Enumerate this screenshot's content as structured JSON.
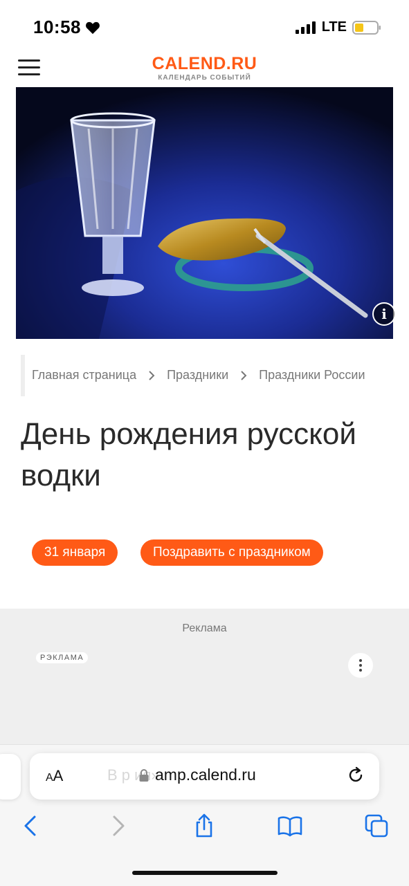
{
  "status_bar": {
    "time": "10:58",
    "network": "LTE",
    "heart_icon": "heart-icon",
    "signal_icon": "signal-bars-icon",
    "battery_icon": "battery-icon"
  },
  "header": {
    "menu_icon": "hamburger-icon",
    "logo_main": "CALEND.RU",
    "logo_sub": "КАЛЕНДАРЬ СОБЫТИЙ",
    "brand_color": "#ff5a16"
  },
  "hero": {
    "info_label": "i"
  },
  "breadcrumb": {
    "items": [
      "Главная страница",
      "Праздники",
      "Праздники России"
    ],
    "separator": ">"
  },
  "page": {
    "title": "День рождения русской водки",
    "date_button": "31 января",
    "congrats_button": "Поздравить с праздником"
  },
  "ad": {
    "caption": "Реклама",
    "badge": "РЭКЛАМА"
  },
  "safari": {
    "aa_label_small": "A",
    "aa_label_big": "A",
    "ghost_text": "В р           ия»",
    "url": "amp.calend.ru",
    "toolbar": [
      "back-icon",
      "forward-icon",
      "share-icon",
      "bookmarks-icon",
      "tabs-icon"
    ]
  }
}
